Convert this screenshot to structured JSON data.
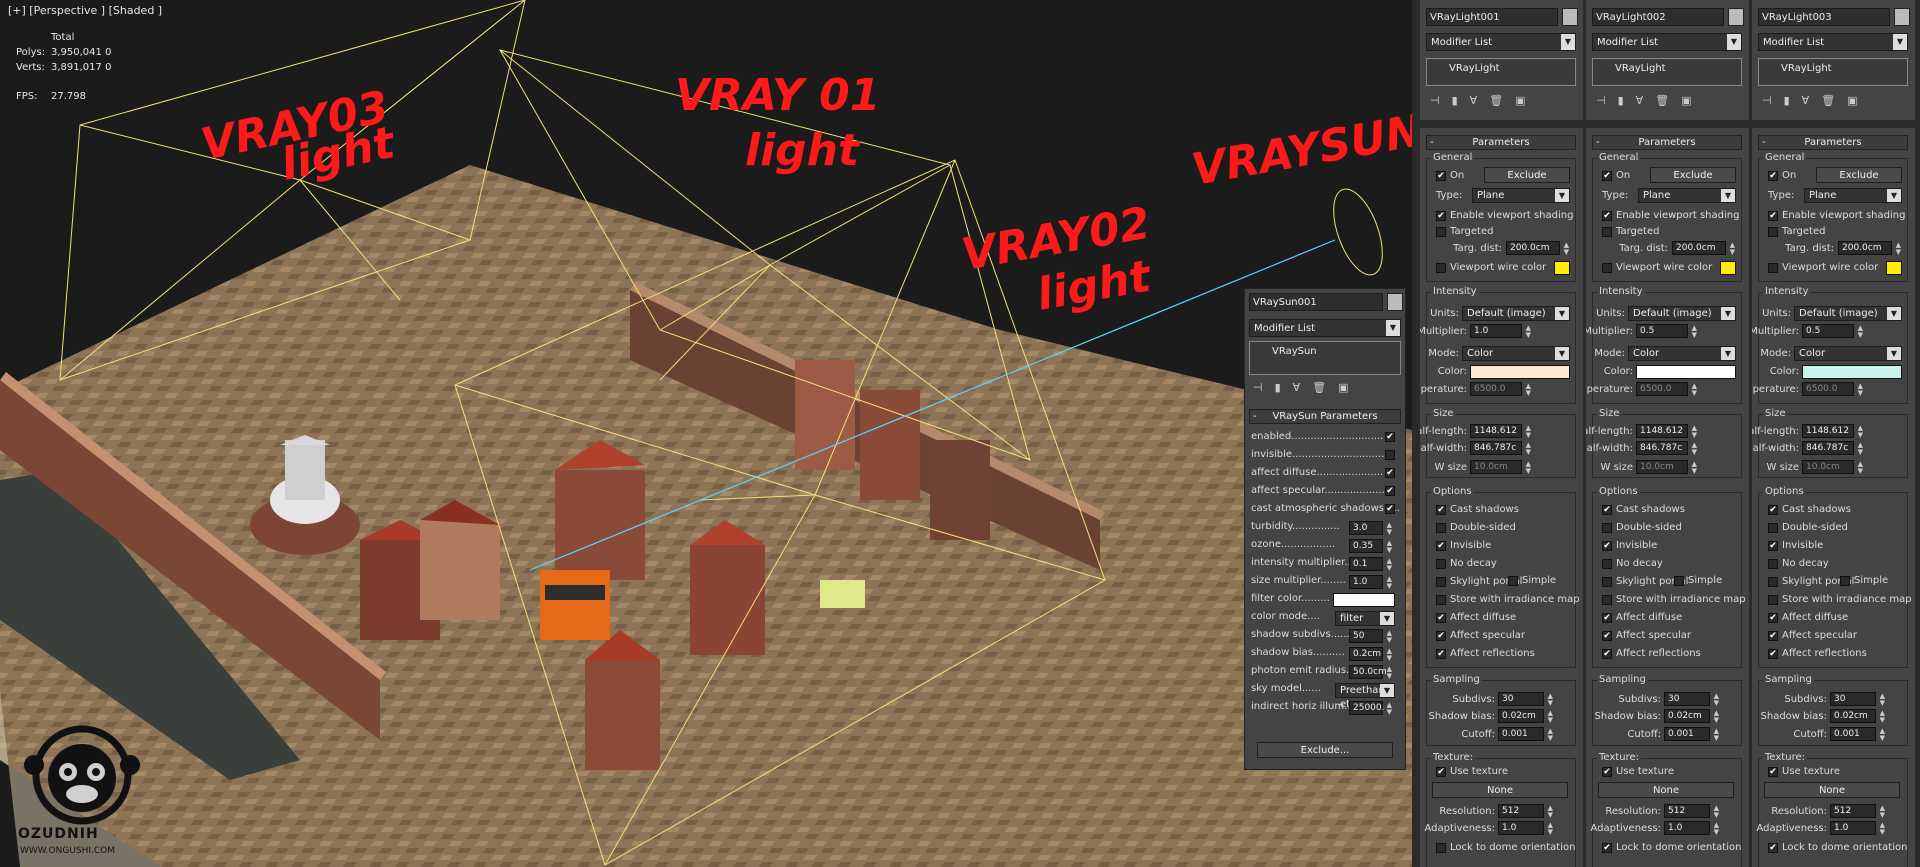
{
  "viewport": {
    "label": "[+] [Perspective ] [Shaded ]",
    "stats": {
      "total_label": "Total",
      "polys_label": "Polys:",
      "polys_value": "3,950,041  0",
      "verts_label": "Verts:",
      "verts_value": "3,891,017  0",
      "fps_label": "FPS:",
      "fps_value": "27.798"
    },
    "annotations": {
      "vray03_a": "VRAY03",
      "vray03_b": "light",
      "vray01_a": "VRAY 01",
      "vray01_b": "light",
      "vray02_a": "VRAY02",
      "vray02_b": "light",
      "vraysun": "VRAYSUN"
    },
    "logo": {
      "brand": "OZUDNIH",
      "url": "WWW.ONGUSHI.COM"
    }
  },
  "sun_panel": {
    "object_name": "VRaySun001",
    "modifier_list": "Modifier List",
    "stack_item": "VRaySun",
    "toolbar_icons": [
      "pin-stack-icon",
      "show-end-result-icon",
      "make-unique-icon",
      "remove-modifier-icon",
      "configure-sets-icon"
    ],
    "rollout_title": "VRaySun Parameters",
    "params": [
      {
        "label": "enabled.............................",
        "type": "check",
        "checked": true
      },
      {
        "label": "invisible.............................",
        "type": "check",
        "checked": false
      },
      {
        "label": "affect diffuse.....................",
        "type": "check",
        "checked": true
      },
      {
        "label": "affect specular...................",
        "type": "check",
        "checked": true
      },
      {
        "label": "cast atmospheric shadows.....",
        "type": "check",
        "checked": true
      },
      {
        "label": "turbidity...............",
        "type": "spin",
        "value": "3.0"
      },
      {
        "label": "ozone.................",
        "type": "spin",
        "value": "0.35"
      },
      {
        "label": "intensity multiplier...",
        "type": "spin",
        "value": "0.1"
      },
      {
        "label": "size multiplier........",
        "type": "spin",
        "value": "1.0"
      },
      {
        "label": "filter color.........",
        "type": "color",
        "value": "#ffffff"
      },
      {
        "label": "color mode....",
        "type": "dropdown",
        "value": "filter"
      },
      {
        "label": "shadow subdivs.......",
        "type": "spin",
        "value": "50"
      },
      {
        "label": "shadow bias..........",
        "type": "spin",
        "value": "0.2cm"
      },
      {
        "label": "photon emit radius.",
        "type": "spin",
        "value": "50.0cm"
      },
      {
        "label": "sky model......",
        "type": "dropdown",
        "value": "Preetham et"
      },
      {
        "label": "indirect horiz illum..",
        "type": "spin",
        "value": "25000."
      }
    ],
    "exclude_button": "Exclude..."
  },
  "light_panels": [
    {
      "object_name": "VRayLight001",
      "modifier_list": "Modifier List",
      "stack_item": "VRayLight",
      "parameters_title": "Parameters",
      "general_title": "General",
      "on_label": "On",
      "on": true,
      "exclude_label": "Exclude",
      "type_label": "Type:",
      "type_value": "Plane",
      "viewport_shading_label": "Enable viewport shading",
      "viewport_shading": true,
      "targeted_label": "Targeted",
      "targeted": false,
      "targ_dist_label": "Targ. dist:",
      "targ_dist_value": "200.0cm",
      "wire_color_label": "Viewport wire color",
      "wire_color": "#ffee00",
      "intensity_title": "Intensity",
      "units_label": "Units:",
      "units_value": "Default (image)",
      "multiplier_label": "Multiplier:",
      "multiplier_value": "1.0",
      "mode_label": "Mode:",
      "mode_value": "Color",
      "color_label": "Color:",
      "color_value": "#ffe9d0",
      "temperature_label": "Temperature:",
      "temperature_value": "6500.0",
      "size_title": "Size",
      "half_length_label": "Half-length:",
      "half_length_value": "1148.612",
      "half_width_label": "Half-width:",
      "half_width_value": "846.787c",
      "w_size_label": "W size",
      "w_size_value": "10.0cm",
      "options_title": "Options",
      "options": [
        {
          "label": "Cast shadows",
          "checked": true
        },
        {
          "label": "Double-sided",
          "checked": false
        },
        {
          "label": "Invisible",
          "checked": true
        },
        {
          "label": "No decay",
          "checked": false
        },
        {
          "label": "Skylight portal",
          "checked": false
        },
        {
          "label": "Store with irradiance map",
          "checked": false
        },
        {
          "label": "Affect diffuse",
          "checked": true
        },
        {
          "label": "Affect specular",
          "checked": true
        },
        {
          "label": "Affect reflections",
          "checked": true
        }
      ],
      "simple_label": "Simple",
      "sampling_title": "Sampling",
      "subdivs_label": "Subdivs:",
      "subdivs_value": "30",
      "shadow_bias_label": "Shadow bias:",
      "shadow_bias_value": "0.02cm",
      "cutoff_label": "Cutoff:",
      "cutoff_value": "0.001",
      "texture_title": "Texture:",
      "use_texture_label": "Use texture",
      "use_texture": true,
      "none_label": "None",
      "resolution_label": "Resolution:",
      "resolution_value": "512",
      "adaptiveness_label": "Adaptiveness:",
      "adaptiveness_value": "1.0",
      "lock_dome_label": "Lock to dome orientation",
      "lock_dome": false
    },
    {
      "object_name": "VRayLight002",
      "modifier_list": "Modifier List",
      "stack_item": "VRayLight",
      "parameters_title": "Parameters",
      "general_title": "General",
      "on_label": "On",
      "on": true,
      "exclude_label": "Exclude",
      "type_label": "Type:",
      "type_value": "Plane",
      "viewport_shading_label": "Enable viewport shading",
      "viewport_shading": true,
      "targeted_label": "Targeted",
      "targeted": false,
      "targ_dist_label": "Targ. dist:",
      "targ_dist_value": "200.0cm",
      "wire_color_label": "Viewport wire color",
      "wire_color": "#ffee00",
      "intensity_title": "Intensity",
      "units_label": "Units:",
      "units_value": "Default (image)",
      "multiplier_label": "Multiplier:",
      "multiplier_value": "0.5",
      "mode_label": "Mode:",
      "mode_value": "Color",
      "color_label": "Color:",
      "color_value": "#ffffff",
      "temperature_label": "Temperature:",
      "temperature_value": "6500.0",
      "size_title": "Size",
      "half_length_label": "Half-length:",
      "half_length_value": "1148.612",
      "half_width_label": "Half-width:",
      "half_width_value": "846.787c",
      "w_size_label": "W size",
      "w_size_value": "10.0cm",
      "options_title": "Options",
      "options": [
        {
          "label": "Cast shadows",
          "checked": true
        },
        {
          "label": "Double-sided",
          "checked": false
        },
        {
          "label": "Invisible",
          "checked": true
        },
        {
          "label": "No decay",
          "checked": false
        },
        {
          "label": "Skylight portal",
          "checked": false
        },
        {
          "label": "Store with irradiance map",
          "checked": false
        },
        {
          "label": "Affect diffuse",
          "checked": true
        },
        {
          "label": "Affect specular",
          "checked": true
        },
        {
          "label": "Affect reflections",
          "checked": true
        }
      ],
      "simple_label": "Simple",
      "sampling_title": "Sampling",
      "subdivs_label": "Subdivs:",
      "subdivs_value": "30",
      "shadow_bias_label": "Shadow bias:",
      "shadow_bias_value": "0.02cm",
      "cutoff_label": "Cutoff:",
      "cutoff_value": "0.001",
      "texture_title": "Texture:",
      "use_texture_label": "Use texture",
      "use_texture": true,
      "none_label": "None",
      "resolution_label": "Resolution:",
      "resolution_value": "512",
      "adaptiveness_label": "Adaptiveness:",
      "adaptiveness_value": "1.0",
      "lock_dome_label": "Lock to dome orientation",
      "lock_dome": true
    },
    {
      "object_name": "VRayLight003",
      "modifier_list": "Modifier List",
      "stack_item": "VRayLight",
      "parameters_title": "Parameters",
      "general_title": "General",
      "on_label": "On",
      "on": true,
      "exclude_label": "Exclude",
      "type_label": "Type:",
      "type_value": "Plane",
      "viewport_shading_label": "Enable viewport shading",
      "viewport_shading": true,
      "targeted_label": "Targeted",
      "targeted": false,
      "targ_dist_label": "Targ. dist:",
      "targ_dist_value": "200.0cm",
      "wire_color_label": "Viewport wire color",
      "wire_color": "#ffee00",
      "intensity_title": "Intensity",
      "units_label": "Units:",
      "units_value": "Default (image)",
      "multiplier_label": "Multiplier:",
      "multiplier_value": "0.5",
      "mode_label": "Mode:",
      "mode_value": "Color",
      "color_label": "Color:",
      "color_value": "#c9f2ea",
      "temperature_label": "Temperature:",
      "temperature_value": "6500.0",
      "size_title": "Size",
      "half_length_label": "Half-length:",
      "half_length_value": "1148.612",
      "half_width_label": "Half-width:",
      "half_width_value": "846.787c",
      "w_size_label": "W size",
      "w_size_value": "10.0cm",
      "options_title": "Options",
      "options": [
        {
          "label": "Cast shadows",
          "checked": true
        },
        {
          "label": "Double-sided",
          "checked": false
        },
        {
          "label": "Invisible",
          "checked": true
        },
        {
          "label": "No decay",
          "checked": false
        },
        {
          "label": "Skylight portal",
          "checked": false
        },
        {
          "label": "Store with irradiance map",
          "checked": false
        },
        {
          "label": "Affect diffuse",
          "checked": true
        },
        {
          "label": "Affect specular",
          "checked": true
        },
        {
          "label": "Affect reflections",
          "checked": true
        }
      ],
      "simple_label": "Simple",
      "sampling_title": "Sampling",
      "subdivs_label": "Subdivs:",
      "subdivs_value": "30",
      "shadow_bias_label": "Shadow bias:",
      "shadow_bias_value": "0.02cm",
      "cutoff_label": "Cutoff:",
      "cutoff_value": "0.001",
      "texture_title": "Texture:",
      "use_texture_label": "Use texture",
      "use_texture": true,
      "none_label": "None",
      "resolution_label": "Resolution:",
      "resolution_value": "512",
      "adaptiveness_label": "Adaptiveness:",
      "adaptiveness_value": "1.0",
      "lock_dome_label": "Lock to dome orientation",
      "lock_dome": true
    }
  ]
}
